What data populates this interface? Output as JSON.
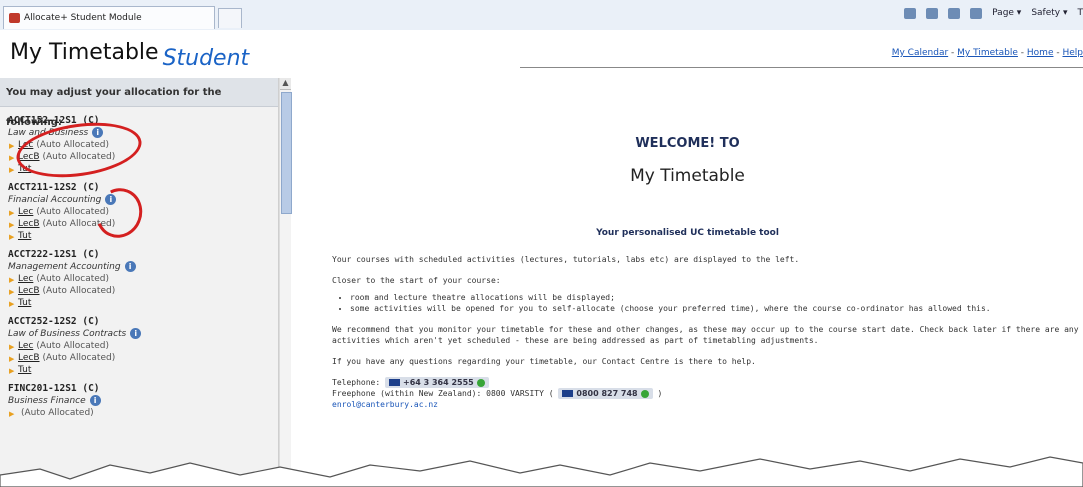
{
  "browser": {
    "tab_title": "Allocate+ Student Module",
    "tools": [
      "Page ▾",
      "Safety ▾",
      "T"
    ]
  },
  "header": {
    "title": "My Timetable",
    "subtitle": "Student",
    "nav": {
      "my_calendar": "My Calendar",
      "my_timetable": "My Timetable",
      "home": "Home",
      "help": "Help",
      "sep": " - "
    }
  },
  "sidebar": {
    "heading": "You may adjust your allocation for the following:",
    "courses": [
      {
        "code": "ACCT152-12S1 (C)",
        "name": "Law and Business",
        "activities": [
          {
            "label": "Lec",
            "status": "(Auto Allocated)"
          },
          {
            "label": "LecB",
            "status": "(Auto Allocated)"
          },
          {
            "label": "Tut",
            "status": ""
          }
        ]
      },
      {
        "code": "ACCT211-12S2 (C)",
        "name": "Financial Accounting",
        "activities": [
          {
            "label": "Lec",
            "status": "(Auto Allocated)"
          },
          {
            "label": "LecB",
            "status": "(Auto Allocated)"
          },
          {
            "label": "Tut",
            "status": ""
          }
        ]
      },
      {
        "code": "ACCT222-12S1 (C)",
        "name": "Management Accounting",
        "activities": [
          {
            "label": "Lec",
            "status": "(Auto Allocated)"
          },
          {
            "label": "LecB",
            "status": "(Auto Allocated)"
          },
          {
            "label": "Tut",
            "status": ""
          }
        ]
      },
      {
        "code": "ACCT252-12S2 (C)",
        "name": "Law of Business Contracts",
        "activities": [
          {
            "label": "Lec",
            "status": "(Auto Allocated)"
          },
          {
            "label": "LecB",
            "status": "(Auto Allocated)"
          },
          {
            "label": "Tut",
            "status": ""
          }
        ]
      },
      {
        "code": "FINC201-12S1 (C)",
        "name": "Business Finance",
        "activities": [
          {
            "label": "",
            "status": "(Auto Allocated)"
          }
        ]
      }
    ]
  },
  "main": {
    "welcome": "WELCOME! TO",
    "title": "My Timetable",
    "tagline": "Your personalised UC timetable tool",
    "p1": "Your courses with scheduled activities (lectures, tutorials, labs etc) are displayed to the left.",
    "p2": "Closer to the start of your course:",
    "bullets": [
      "room and lecture theatre allocations will be displayed;",
      "some activities will be opened for you to self-allocate (choose your preferred time), where the course co-ordinator has allowed this."
    ],
    "p3": "We recommend that you monitor your timetable for these and other changes, as these may occur up to the course start date. Check back later if there are any activities which aren't yet scheduled - these are being addressed as part of timetabling adjustments.",
    "p4": "If you have any questions regarding your timetable, our Contact Centre is there to help.",
    "telephone_label": "Telephone:",
    "telephone": "+64 3 364 2555",
    "freephone_label": "Freephone (within New Zealand): 0800 VARSITY (",
    "freephone": "0800 827 748",
    "freephone_close": ")",
    "email": "enrol@canterbury.ac.nz"
  },
  "colors": {
    "accent": "#1a63c6",
    "annotation": "#d42020",
    "sidebar_bg": "#f2f2f2"
  }
}
